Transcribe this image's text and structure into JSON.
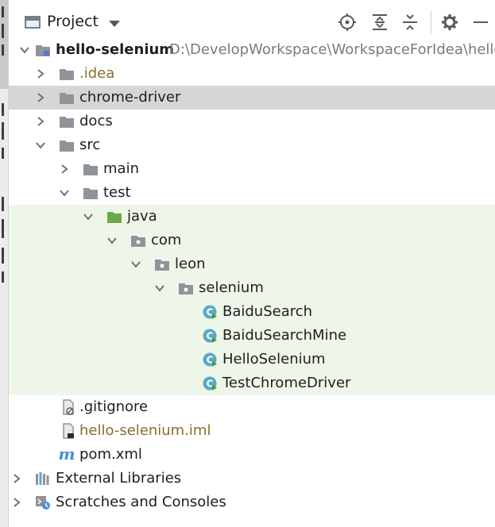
{
  "header": {
    "title": "Project",
    "icons": [
      "project-view-icon",
      "chevron-down-icon",
      "locate-icon",
      "expand-all-icon",
      "collapse-all-icon",
      "gear-icon",
      "minimize-icon"
    ]
  },
  "colors": {
    "selection": "#d6d6d6",
    "test_source_bg": "#eef6e9",
    "folder": "#8f949a",
    "test_folder": "#6fa84a",
    "java_class": "#59a8c8",
    "excluded_text": "#8a6d2f"
  },
  "tree": {
    "root": {
      "name": "hello-selenium",
      "path": "D:\\DevelopWorkspace\\WorkspaceForIdea\\hello-selenium"
    },
    "idea": ".idea",
    "chrome_driver": "chrome-driver",
    "docs": "docs",
    "src": "src",
    "main": "main",
    "test": "test",
    "java": "java",
    "com": "com",
    "leon": "leon",
    "selenium": "selenium",
    "classes": [
      "BaiduSearch",
      "BaiduSearchMine",
      "HelloSelenium",
      "TestChromeDriver"
    ],
    "gitignore": ".gitignore",
    "iml": "hello-selenium.iml",
    "pom": "pom.xml",
    "external_libraries": "External Libraries",
    "scratches": "Scratches and Consoles"
  }
}
